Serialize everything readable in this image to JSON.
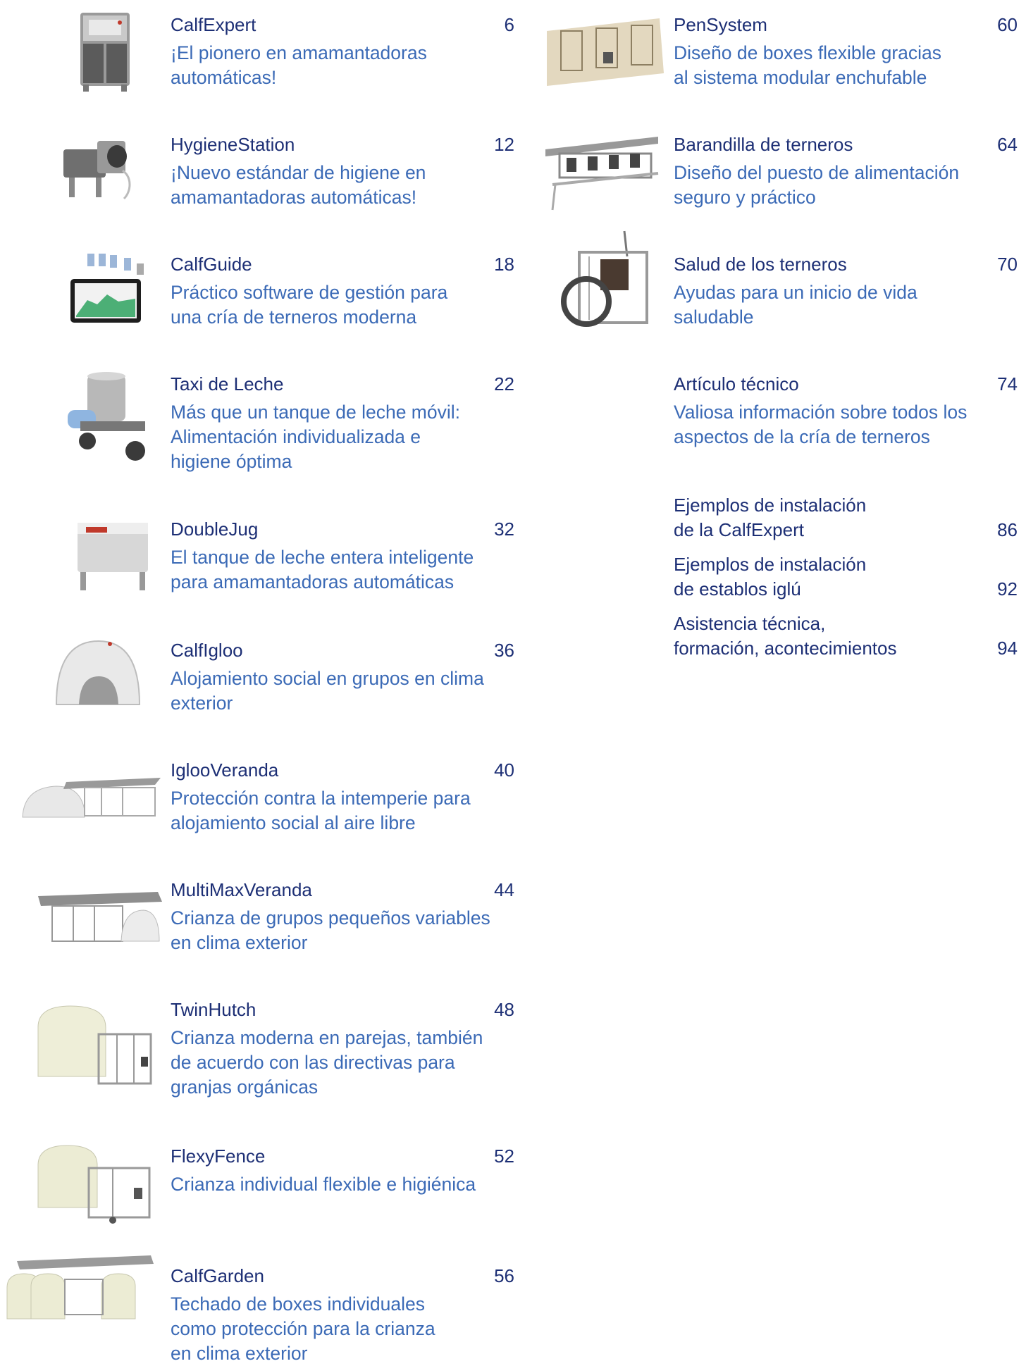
{
  "left_column": [
    {
      "title": "CalfExpert",
      "page": "6",
      "lines": [
        "¡El pionero en amamantadoras",
        "automáticas!"
      ],
      "icon": "calfexpert-machine-icon"
    },
    {
      "title": "HygieneStation",
      "page": "12",
      "lines": [
        "¡Nuevo estándar de higiene en",
        "amamantadoras automáticas!"
      ],
      "icon": "hygiene-station-icon"
    },
    {
      "title": "CalfGuide",
      "page": "18",
      "lines": [
        "Práctico software de gestión para",
        "una cría de terneros moderna"
      ],
      "icon": "calfguide-tablet-icon"
    },
    {
      "title": "Taxi de Leche",
      "page": "22",
      "lines": [
        "Más que un tanque de leche móvil:",
        "Alimentación individualizada e",
        "higiene óptima"
      ],
      "icon": "milk-taxi-icon"
    },
    {
      "title": "DoubleJug",
      "page": "32",
      "lines": [
        "El tanque de leche entera inteligente",
        "para amamantadoras automáticas"
      ],
      "icon": "doublejug-tank-icon"
    },
    {
      "title": "CalfIgloo",
      "page": "36",
      "lines": [
        "Alojamiento social en grupos en clima",
        "exterior"
      ],
      "icon": "calf-igloo-icon"
    },
    {
      "title": "IglooVeranda",
      "page": "40",
      "lines": [
        "Protección contra la intemperie para",
        "alojamiento social al aire libre"
      ],
      "icon": "igloo-veranda-icon"
    },
    {
      "title": "MultiMaxVeranda",
      "page": "44",
      "lines": [
        "Crianza de grupos pequeños variables",
        "en clima exterior"
      ],
      "icon": "multimax-veranda-icon"
    },
    {
      "title": "TwinHutch",
      "page": "48",
      "lines": [
        "Crianza moderna en parejas, también",
        "de acuerdo con las directivas para",
        "granjas orgánicas"
      ],
      "icon": "twin-hutch-icon"
    },
    {
      "title": "FlexyFence",
      "page": "52",
      "lines": [
        "Crianza individual flexible e higiénica"
      ],
      "icon": "flexy-fence-icon"
    },
    {
      "title": "CalfGarden",
      "page": "56",
      "lines": [
        "Techado de boxes individuales",
        "como protección para la crianza",
        "en clima exterior"
      ],
      "icon": "calf-garden-icon"
    }
  ],
  "right_column": [
    {
      "title": "PenSystem",
      "page": "60",
      "lines": [
        "Diseño de boxes flexible gracias",
        "al sistema modular enchufable"
      ],
      "icon": "pen-system-icon"
    },
    {
      "title": "Barandilla de terneros",
      "page": "64",
      "lines": [
        "Diseño del puesto de alimentación",
        "seguro y práctico"
      ],
      "icon": "calf-railing-icon"
    },
    {
      "title": "Salud de los terneros",
      "page": "70",
      "lines": [
        "Ayudas para un inicio de vida",
        "saludable"
      ],
      "icon": "calf-health-cart-icon"
    },
    {
      "title": "Artículo técnico",
      "page": "74",
      "lines": [
        "Valiosa información sobre todos los",
        "aspectos de la cría de terneros"
      ],
      "icon": ""
    }
  ],
  "multi_entries": [
    {
      "lines": [
        "Ejemplos de instalación",
        "de la CalfExpert"
      ],
      "page": "86"
    },
    {
      "lines": [
        "Ejemplos de instalación",
        "de establos iglú"
      ],
      "page": "92"
    },
    {
      "lines": [
        "Asistencia técnica,",
        "formación, acontecimientos"
      ],
      "page": "94"
    }
  ],
  "colors": {
    "title": "#1d2f75",
    "description": "#3b6ab6",
    "background": "#ffffff"
  }
}
